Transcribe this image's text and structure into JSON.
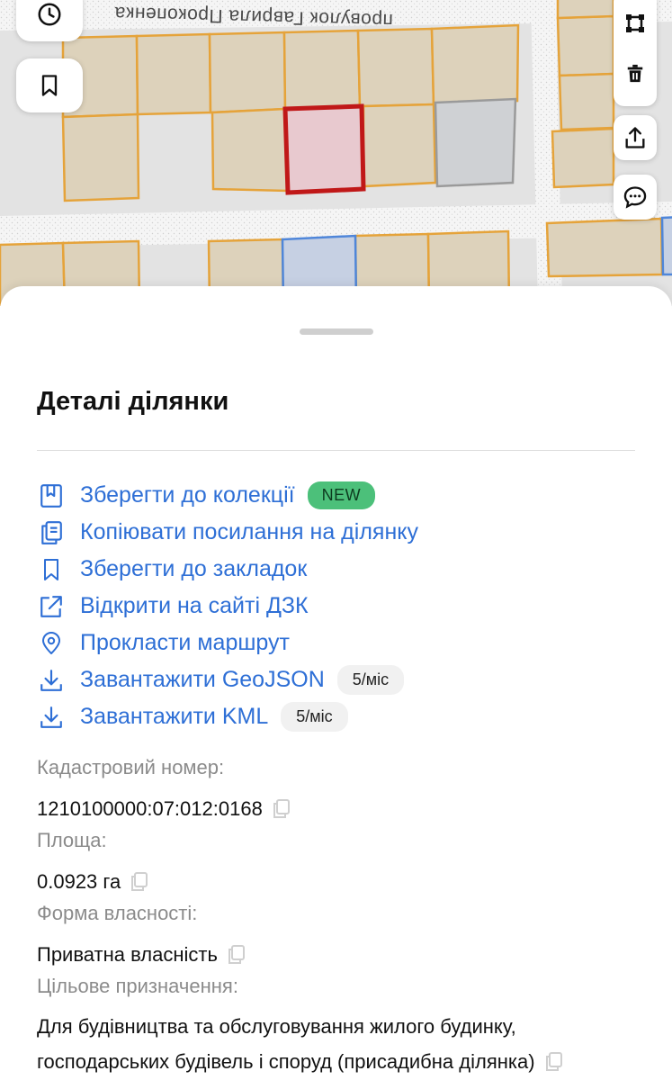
{
  "map": {
    "street_name": "провулок Гаврила Прокопенка",
    "colors": {
      "background": "#e6e6e6",
      "street": "#f4f4f4",
      "parcel_fill": "#ddd2bb",
      "parcel_border": "#e5a33a",
      "selected_fill": "#e8c9cf",
      "selected_border": "#c01818",
      "gray_fill": "#cfd1d4",
      "blue_fill": "#c6d0e3",
      "blue_border": "#4f86d9"
    },
    "buttons": {
      "history_icon": "clock-icon",
      "bookmark_icon": "bookmark-icon",
      "polygon_icon": "polygon-icon",
      "delete_icon": "trash-icon",
      "share_icon": "share-icon",
      "chat_icon": "chat-icon"
    }
  },
  "sheet": {
    "title": "Деталі ділянки",
    "actions": [
      {
        "icon": "collection-icon",
        "label": "Зберегти до колекції",
        "badge": "NEW"
      },
      {
        "icon": "copy-link-icon",
        "label": "Копіювати посилання на ділянку"
      },
      {
        "icon": "bookmark-icon",
        "label": "Зберегти до закладок"
      },
      {
        "icon": "external-link-icon",
        "label": "Відкрити на сайті ДЗК"
      },
      {
        "icon": "location-pin-icon",
        "label": "Прокласти маршрут"
      },
      {
        "icon": "download-icon",
        "label": "Завантажити GeoJSON",
        "badge": "5/міс"
      },
      {
        "icon": "download-icon",
        "label": "Завантажити KML",
        "badge": "5/міс"
      }
    ],
    "info": {
      "cadastral_label": "Кадастровий номер:",
      "cadastral_value": "1210100000:07:012:0168",
      "area_label": "Площа:",
      "area_value": "0.0923 га",
      "ownership_label": "Форма власності:",
      "ownership_value": "Приватна власність",
      "purpose_label": "Цільове призначення:",
      "purpose_value_line1": "Для будівництва та обслуговування жилого будинку,",
      "purpose_value_line2": "господарських будівель і споруд (присадибна ділянка)"
    },
    "accent_color": "#2e6fd6",
    "new_badge_color": "#4cc07a"
  }
}
